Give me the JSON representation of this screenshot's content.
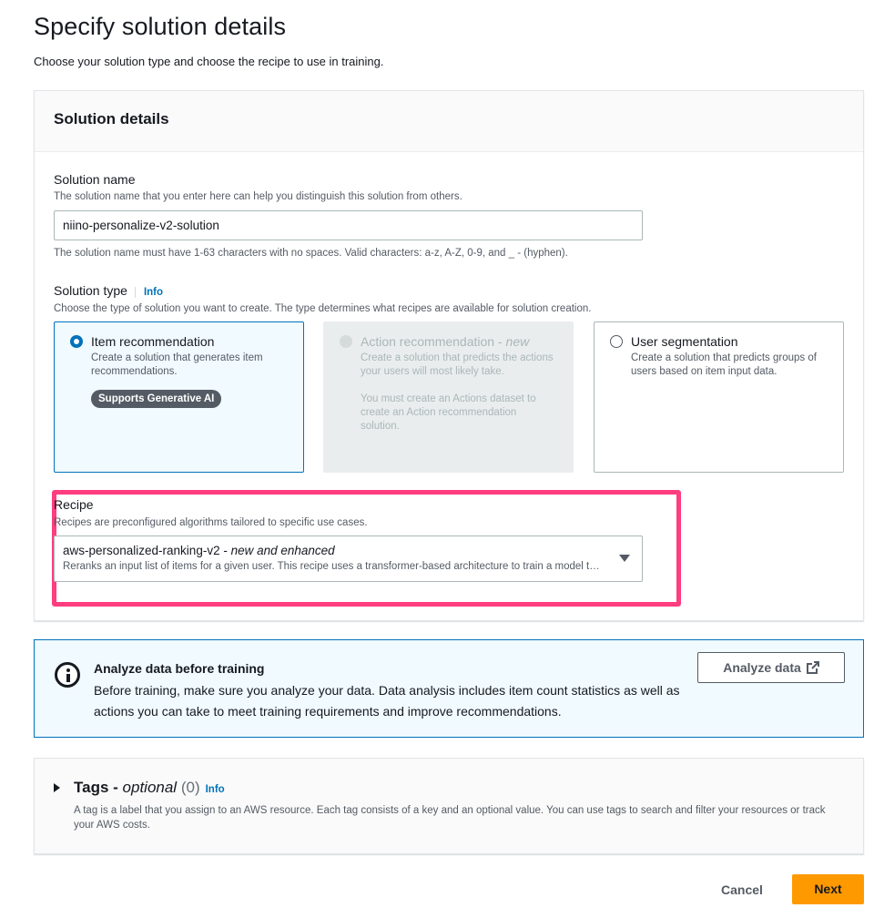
{
  "page": {
    "title": "Specify solution details",
    "description": "Choose your solution type and choose the recipe to use in training."
  },
  "solution_details": {
    "header": "Solution details",
    "name": {
      "label": "Solution name",
      "description": "The solution name that you enter here can help you distinguish this solution from others.",
      "value": "niino-personalize-v2-solution",
      "constraint": "The solution name must have 1-63 characters with no spaces. Valid characters: a-z, A-Z, 0-9, and _ - (hyphen)."
    },
    "type": {
      "label": "Solution type",
      "info": "Info",
      "description": "Choose the type of solution you want to create. The type determines what recipes are available for solution creation.",
      "options": [
        {
          "title": "Item recommendation",
          "description": "Create a solution that generates item recommendations.",
          "badge": "Supports Generative AI",
          "state": "selected"
        },
        {
          "title": "Action recommendation - ",
          "title_suffix": "new",
          "description": "Create a solution that predicts the actions your users will most likely take.",
          "note": "You must create an Actions dataset to create an Action recommendation solution.",
          "state": "disabled"
        },
        {
          "title": "User segmentation",
          "description": "Create a solution that predicts groups of users based on item input data.",
          "state": "unselected"
        }
      ]
    },
    "recipe": {
      "label": "Recipe",
      "description": "Recipes are preconfigured algorithms tailored to specific use cases.",
      "selected_name": "aws-personalized-ranking-v2 - ",
      "selected_tag": "new and enhanced",
      "selected_description": "Reranks an input list of items for a given user. This recipe uses a transformer-based architecture to train a model that learns from user interactions and item metadata."
    }
  },
  "alert": {
    "title": "Analyze data before training",
    "body": "Before training, make sure you analyze your data. Data analysis includes item count statistics as well as actions you can take to meet training requirements and improve recommendations.",
    "button_label": "Analyze data"
  },
  "tags": {
    "title": "Tags - ",
    "optional": "optional",
    "count": "(0)",
    "info": "Info",
    "description": "A tag is a label that you assign to an AWS resource. Each tag consists of a key and an optional value. You can use tags to search and filter your resources or track your AWS costs."
  },
  "footer": {
    "cancel_label": "Cancel",
    "next_label": "Next"
  },
  "colors": {
    "primary_button": "#ff9900",
    "selected_border": "#0073bb",
    "highlight": "#ff3d7f",
    "link": "#0073bb"
  }
}
